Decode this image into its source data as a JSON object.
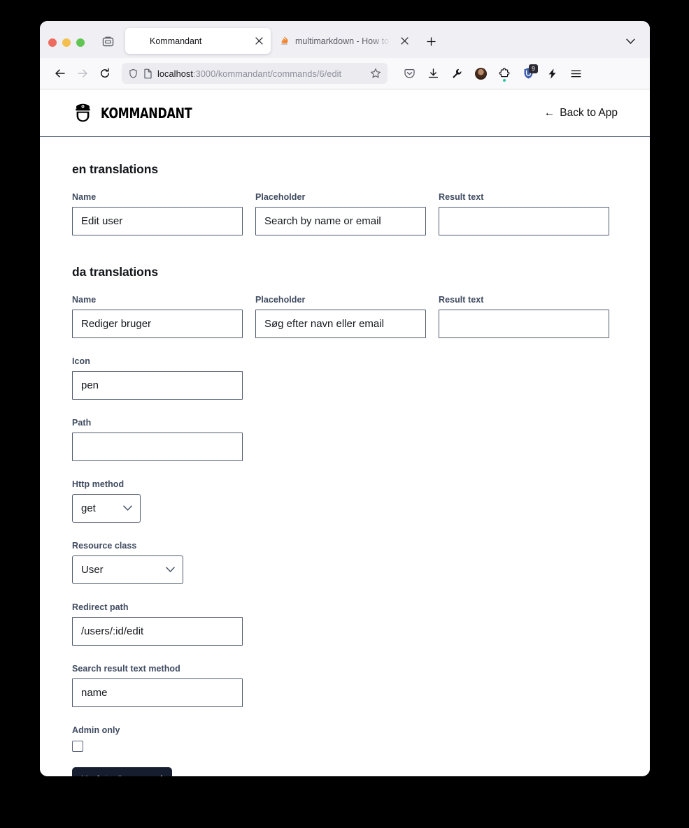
{
  "browser": {
    "traffic_lights": [
      "close",
      "minimize",
      "maximize"
    ],
    "tabs": [
      {
        "title": "Kommandant",
        "favicon": "blank-page-icon",
        "active": true
      },
      {
        "title": "multimarkdown - How to link to",
        "favicon": "stackoverflow-icon",
        "active": false
      }
    ],
    "url": {
      "host": "localhost",
      "rest": ":3000/kommandant/commands/6/edit"
    },
    "toolbar_icons": [
      "pocket-icon",
      "downloads-icon",
      "wrench-icon",
      "account-avatar-icon",
      "extensions-puzzle-icon",
      "ublock-origin-icon",
      "lightning-icon",
      "hamburger-menu-icon"
    ],
    "ublock_badge": "9"
  },
  "app": {
    "brand": "KOMMANDANT",
    "back_link": "Back to App",
    "back_arrow": "←"
  },
  "form": {
    "sections": [
      {
        "title": "en translations",
        "fields": [
          {
            "label": "Name",
            "value": "Edit user"
          },
          {
            "label": "Placeholder",
            "value": "Search by name or email"
          },
          {
            "label": "Result text",
            "value": ""
          }
        ]
      },
      {
        "title": "da translations",
        "fields": [
          {
            "label": "Name",
            "value": "Rediger bruger"
          },
          {
            "label": "Placeholder",
            "value": "Søg efter navn eller email"
          },
          {
            "label": "Result text",
            "value": ""
          }
        ]
      }
    ],
    "icon_field": {
      "label": "Icon",
      "value": "pen"
    },
    "path_field": {
      "label": "Path",
      "value": ""
    },
    "http_method": {
      "label": "Http method",
      "value": "get"
    },
    "resource_class": {
      "label": "Resource class",
      "value": "User"
    },
    "redirect_path": {
      "label": "Redirect path",
      "value": "/users/:id/edit"
    },
    "search_result_text_method": {
      "label": "Search result text method",
      "value": "name"
    },
    "admin_only": {
      "label": "Admin only",
      "checked": false
    },
    "submit_label": "Update Command"
  },
  "colors": {
    "button_bg": "#161d2f",
    "label": "#3f4b60",
    "input_border": "#4e5a6e",
    "header_border": "#5b6580"
  }
}
